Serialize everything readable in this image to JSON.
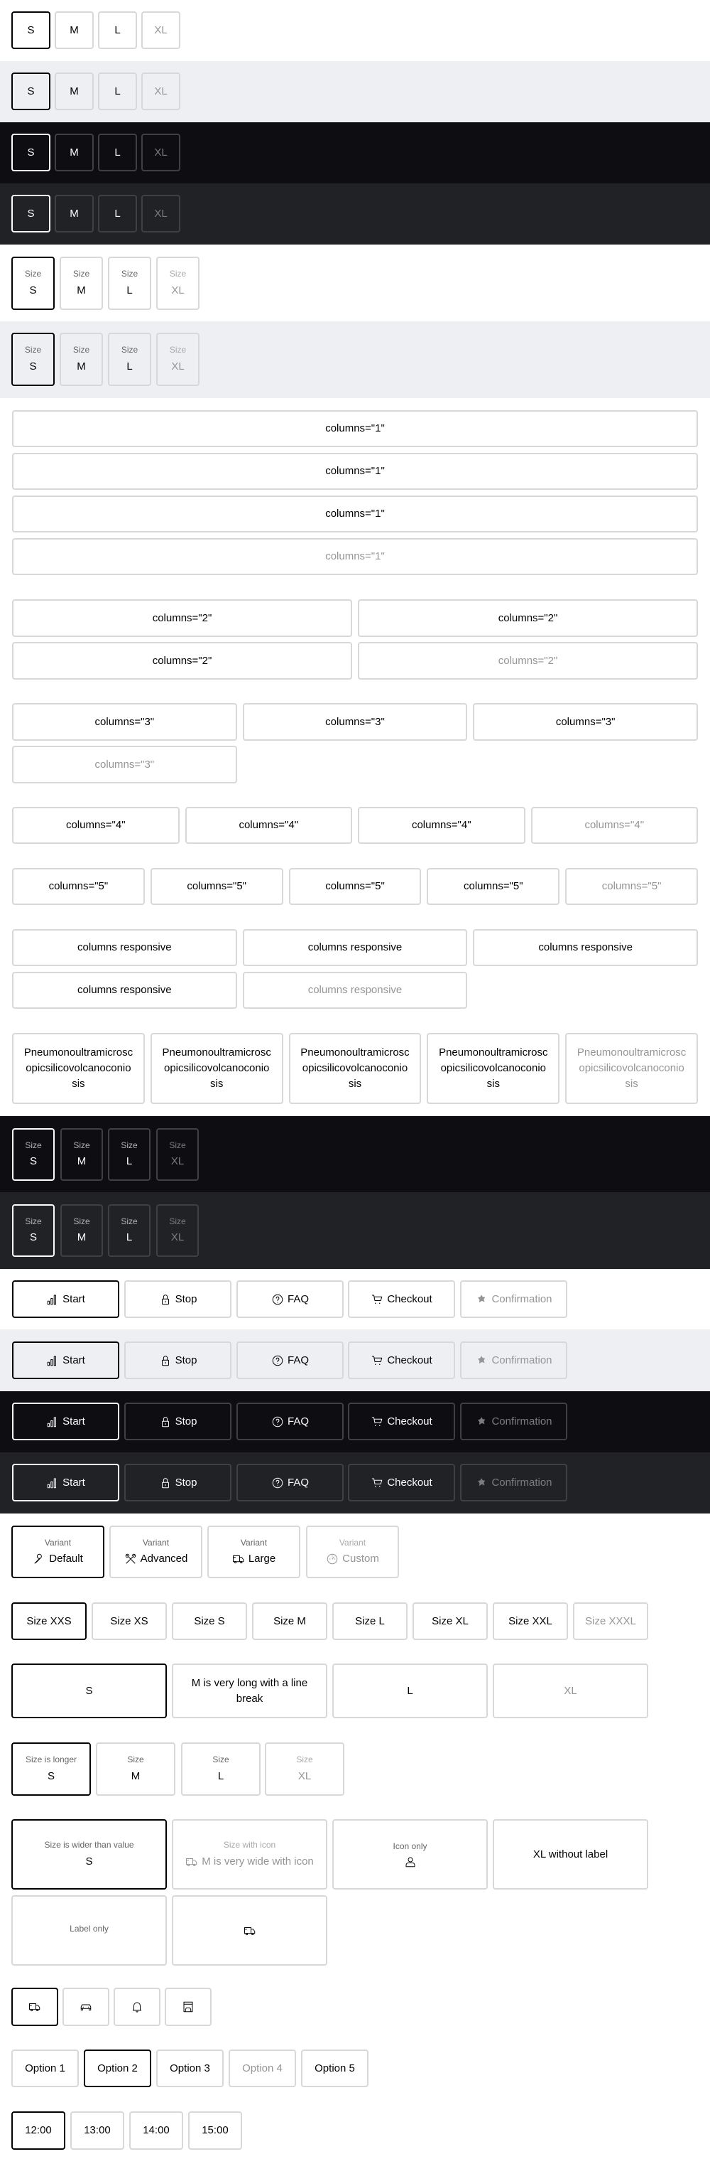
{
  "colors": {
    "selected_border": "#010205",
    "border": "#d8d8db",
    "surface": "#eeeff2",
    "dark": "#0e0e12",
    "dark_surface": "#212225",
    "disabled_text": "#949598"
  },
  "groups": [
    {
      "theme": "light",
      "items": [
        {
          "value": "S",
          "selected": true
        },
        {
          "value": "M"
        },
        {
          "value": "L"
        },
        {
          "value": "XL",
          "disabled": true
        }
      ]
    },
    {
      "theme": "surface",
      "items": [
        {
          "value": "S",
          "selected": true
        },
        {
          "value": "M"
        },
        {
          "value": "L"
        },
        {
          "value": "XL",
          "disabled": true
        }
      ]
    },
    {
      "theme": "dark",
      "items": [
        {
          "value": "S",
          "selected": true
        },
        {
          "value": "M"
        },
        {
          "value": "L"
        },
        {
          "value": "XL",
          "disabled": true
        }
      ]
    },
    {
      "theme": "darksurface",
      "items": [
        {
          "value": "S",
          "selected": true
        },
        {
          "value": "M"
        },
        {
          "value": "L"
        },
        {
          "value": "XL",
          "disabled": true
        }
      ]
    },
    {
      "theme": "light",
      "items": [
        {
          "label": "Size",
          "value": "S",
          "selected": true
        },
        {
          "label": "Size",
          "value": "M"
        },
        {
          "label": "Size",
          "value": "L"
        },
        {
          "label": "Size",
          "value": "XL",
          "disabled": true
        }
      ]
    },
    {
      "theme": "surface",
      "items": [
        {
          "label": "Size",
          "value": "S",
          "selected": true
        },
        {
          "label": "Size",
          "value": "M"
        },
        {
          "label": "Size",
          "value": "L"
        },
        {
          "label": "Size",
          "value": "XL",
          "disabled": true
        }
      ]
    },
    {
      "theme": "light",
      "items": [
        {
          "value": "columns=\"1\""
        },
        {
          "value": "columns=\"1\""
        },
        {
          "value": "columns=\"1\""
        },
        {
          "value": "columns=\"1\"",
          "disabled": true
        }
      ]
    },
    {
      "theme": "light",
      "items": [
        {
          "value": "columns=\"2\""
        },
        {
          "value": "columns=\"2\""
        },
        {
          "value": "columns=\"2\""
        },
        {
          "value": "columns=\"2\"",
          "disabled": true
        }
      ]
    },
    {
      "theme": "light",
      "items": [
        {
          "value": "columns=\"3\""
        },
        {
          "value": "columns=\"3\""
        },
        {
          "value": "columns=\"3\""
        },
        {
          "value": "columns=\"3\"",
          "disabled": true
        }
      ]
    },
    {
      "theme": "light",
      "items": [
        {
          "value": "columns=\"4\""
        },
        {
          "value": "columns=\"4\""
        },
        {
          "value": "columns=\"4\""
        },
        {
          "value": "columns=\"4\"",
          "disabled": true
        }
      ]
    },
    {
      "theme": "light",
      "items": [
        {
          "value": "columns=\"5\""
        },
        {
          "value": "columns=\"5\""
        },
        {
          "value": "columns=\"5\""
        },
        {
          "value": "columns=\"5\""
        },
        {
          "value": "columns=\"5\"",
          "disabled": true
        }
      ]
    },
    {
      "theme": "light",
      "items": [
        {
          "value": "columns responsive"
        },
        {
          "value": "columns responsive"
        },
        {
          "value": "columns responsive"
        },
        {
          "value": "columns responsive"
        },
        {
          "value": "columns responsive",
          "disabled": true
        }
      ]
    },
    {
      "theme": "light",
      "items": [
        {
          "value": "Pneumonoultramicroscopicsilicovolcanoconiosis"
        },
        {
          "value": "Pneumonoultramicroscopicsilicovolcanoconiosis"
        },
        {
          "value": "Pneumonoultramicroscopicsilicovolcanoconiosis"
        },
        {
          "value": "Pneumonoultramicroscopicsilicovolcanoconiosis"
        },
        {
          "value": "Pneumonoultramicroscopicsilicovolcanoconiosis",
          "disabled": true
        }
      ]
    },
    {
      "theme": "dark",
      "items": [
        {
          "label": "Size",
          "value": "S",
          "selected": true
        },
        {
          "label": "Size",
          "value": "M"
        },
        {
          "label": "Size",
          "value": "L"
        },
        {
          "label": "Size",
          "value": "XL",
          "disabled": true
        }
      ]
    },
    {
      "theme": "darksurface",
      "items": [
        {
          "label": "Size",
          "value": "S",
          "selected": true
        },
        {
          "label": "Size",
          "value": "M"
        },
        {
          "label": "Size",
          "value": "L"
        },
        {
          "label": "Size",
          "value": "XL",
          "disabled": true
        }
      ]
    },
    {
      "theme": "light",
      "items": [
        {
          "icon": "chart-icon",
          "value": "Start",
          "selected": true
        },
        {
          "icon": "lock-icon",
          "value": "Stop"
        },
        {
          "icon": "question-icon",
          "value": "FAQ"
        },
        {
          "icon": "cart-icon",
          "value": "Checkout"
        },
        {
          "icon": "confirmation-icon",
          "value": "Confirmation",
          "disabled": true
        }
      ]
    },
    {
      "theme": "surface",
      "items": [
        {
          "icon": "chart-icon",
          "value": "Start",
          "selected": true
        },
        {
          "icon": "lock-icon",
          "value": "Stop"
        },
        {
          "icon": "question-icon",
          "value": "FAQ"
        },
        {
          "icon": "cart-icon",
          "value": "Checkout"
        },
        {
          "icon": "confirmation-icon",
          "value": "Confirmation",
          "disabled": true
        }
      ]
    },
    {
      "theme": "dark",
      "items": [
        {
          "icon": "chart-icon",
          "value": "Start",
          "selected": true
        },
        {
          "icon": "lock-icon",
          "value": "Stop"
        },
        {
          "icon": "question-icon",
          "value": "FAQ"
        },
        {
          "icon": "cart-icon",
          "value": "Checkout"
        },
        {
          "icon": "confirmation-icon",
          "value": "Confirmation",
          "disabled": true
        }
      ]
    },
    {
      "theme": "darksurface",
      "items": [
        {
          "icon": "chart-icon",
          "value": "Start",
          "selected": true
        },
        {
          "icon": "lock-icon",
          "value": "Stop"
        },
        {
          "icon": "question-icon",
          "value": "FAQ"
        },
        {
          "icon": "cart-icon",
          "value": "Checkout"
        },
        {
          "icon": "confirmation-icon",
          "value": "Confirmation",
          "disabled": true
        }
      ]
    },
    {
      "theme": "light",
      "items": [
        {
          "label": "Variant",
          "icon": "wrench-icon",
          "value": "Default",
          "selected": true
        },
        {
          "label": "Variant",
          "icon": "tools-icon",
          "value": "Advanced"
        },
        {
          "label": "Variant",
          "icon": "truck-icon",
          "value": "Large"
        },
        {
          "label": "Variant",
          "icon": "gauge-icon",
          "value": "Custom",
          "disabled": true
        }
      ]
    },
    {
      "theme": "light",
      "items": [
        {
          "value": "Size XXS",
          "selected": true
        },
        {
          "value": "Size XS"
        },
        {
          "value": "Size S"
        },
        {
          "value": "Size M"
        },
        {
          "value": "Size L"
        },
        {
          "value": "Size XL"
        },
        {
          "value": "Size XXL"
        },
        {
          "value": "Size XXXL",
          "disabled": true
        }
      ]
    },
    {
      "theme": "light",
      "items": [
        {
          "value": "S",
          "selected": true
        },
        {
          "value": "M is very long with a line break"
        },
        {
          "value": "L"
        },
        {
          "value": "XL",
          "disabled": true
        }
      ]
    },
    {
      "theme": "light",
      "items": [
        {
          "label": "Size is longer",
          "value": "S",
          "selected": true
        },
        {
          "label": "Size",
          "value": "M"
        },
        {
          "label": "Size",
          "value": "L"
        },
        {
          "label": "Size",
          "value": "XL",
          "disabled": true
        }
      ]
    },
    {
      "theme": "light",
      "items": [
        {
          "label": "Size is wider than value",
          "value": "S",
          "selected": true
        },
        {
          "label": "Size with icon",
          "icon": "truck-icon",
          "value": "M is very wide with icon",
          "disabled": true
        },
        {
          "label": "Icon only",
          "icon": "user-icon"
        },
        {
          "value": "XL without label"
        },
        {
          "label": "Label only"
        },
        {
          "icon": "truck-icon"
        }
      ]
    },
    {
      "theme": "light",
      "items": [
        {
          "icon": "truck-icon",
          "selected": true
        },
        {
          "icon": "car-icon"
        },
        {
          "icon": "bell-icon"
        },
        {
          "icon": "garage-icon"
        }
      ]
    },
    {
      "theme": "light",
      "items": [
        {
          "value": "Option 1"
        },
        {
          "value": "Option 2",
          "selected": true
        },
        {
          "value": "Option 3"
        },
        {
          "value": "Option 4",
          "disabled": true
        },
        {
          "value": "Option 5"
        }
      ]
    },
    {
      "theme": "light",
      "items": [
        {
          "value": "12:00",
          "selected": true
        },
        {
          "value": "13:00"
        },
        {
          "value": "14:00"
        },
        {
          "value": "15:00"
        }
      ]
    }
  ]
}
